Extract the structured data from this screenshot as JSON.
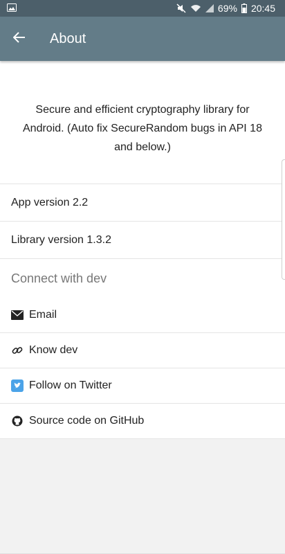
{
  "status_bar": {
    "battery": "69%",
    "time": "20:45",
    "icons": [
      "image-icon",
      "mute-icon",
      "wifi-icon",
      "signal-icon",
      "battery-icon"
    ]
  },
  "app_bar": {
    "title": "About",
    "back_icon": "arrow-back-icon",
    "color": "#637c88"
  },
  "about": {
    "description": "Secure and efficient cryptography library for Android. (Auto fix SecureRandom bugs in API 18 and below.)",
    "app_version": "App version 2.2",
    "library_version": "Library version 1.3.2"
  },
  "connect": {
    "header": "Connect with dev",
    "items": [
      {
        "label": "Email",
        "icon": "email-icon"
      },
      {
        "label": "Know dev",
        "icon": "link-icon"
      },
      {
        "label": "Follow on Twitter",
        "icon": "twitter-icon"
      },
      {
        "label": "Source code on GitHub",
        "icon": "github-icon"
      }
    ]
  },
  "colors": {
    "status_bar": "#4c5f6a",
    "twitter": "#4ba3e8"
  }
}
